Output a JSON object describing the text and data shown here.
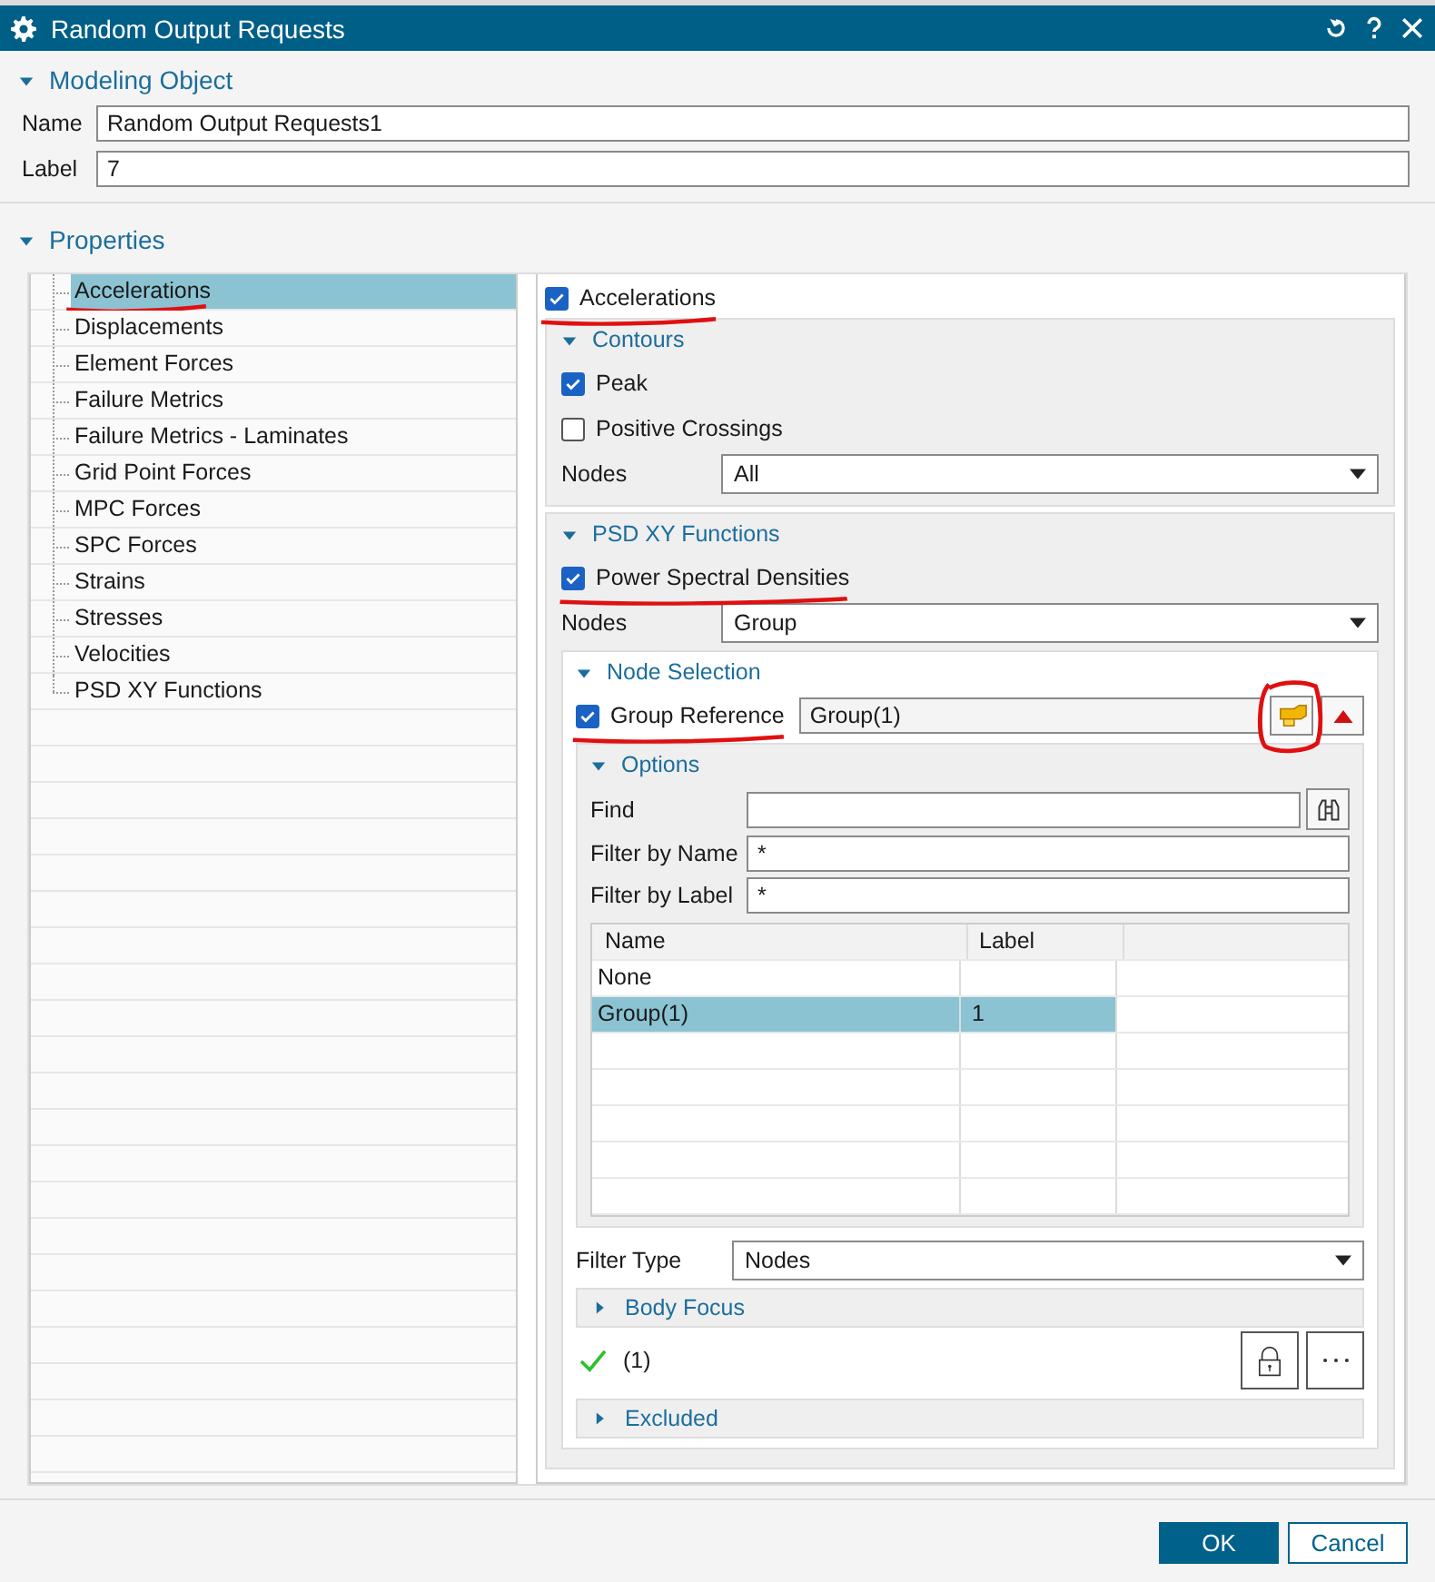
{
  "window": {
    "title": "Random Output Requests"
  },
  "modeling_object": {
    "title": "Modeling Object",
    "expanded": true,
    "fields": [
      {
        "label": "Name",
        "value": "Random Output Requests1"
      },
      {
        "label": "Label",
        "value": "7"
      }
    ]
  },
  "properties": {
    "title": "Properties",
    "expanded": true,
    "tree": [
      {
        "label": "Accelerations",
        "selected": true,
        "underlined": true
      },
      {
        "label": "Displacements",
        "selected": false
      },
      {
        "label": "Element Forces",
        "selected": false
      },
      {
        "label": "Failure Metrics",
        "selected": false
      },
      {
        "label": "Failure Metrics - Laminates",
        "selected": false
      },
      {
        "label": "Grid Point Forces",
        "selected": false
      },
      {
        "label": "MPC Forces",
        "selected": false
      },
      {
        "label": "SPC Forces",
        "selected": false
      },
      {
        "label": "Strains",
        "selected": false
      },
      {
        "label": "Stresses",
        "selected": false
      },
      {
        "label": "Velocities",
        "selected": false
      },
      {
        "label": "PSD XY Functions",
        "selected": false
      }
    ],
    "detail": {
      "enable": {
        "label": "Accelerations",
        "checked": true,
        "underlined": true
      },
      "contours": {
        "title": "Contours",
        "expanded": true,
        "checks": [
          {
            "label": "Peak",
            "checked": true
          },
          {
            "label": "Positive Crossings",
            "checked": false
          }
        ],
        "nodes": {
          "label": "Nodes",
          "value": "All"
        }
      },
      "psd": {
        "title": "PSD XY Functions",
        "expanded": true,
        "check": {
          "label": "Power Spectral Densities",
          "checked": true,
          "underlined": true
        },
        "nodes": {
          "label": "Nodes",
          "value": "Group"
        },
        "node_selection": {
          "title": "Node Selection",
          "expanded": true,
          "group_reference": {
            "label": "Group Reference",
            "checked": true,
            "underlined": true,
            "value": "Group(1)",
            "picker_circled": true
          },
          "options": {
            "title": "Options",
            "expanded": true,
            "find": {
              "label": "Find"
            },
            "filter_name": {
              "label": "Filter by Name",
              "value": "*"
            },
            "filter_label": {
              "label": "Filter by Label",
              "value": "*"
            },
            "table": {
              "columns": [
                "Name",
                "Label"
              ],
              "rows": [
                {
                  "name": "None",
                  "selected": false
                },
                {
                  "name": "Group(1)",
                  "label": "1",
                  "selected": true
                }
              ]
            }
          },
          "filter_type": {
            "label": "Filter Type",
            "value": "Nodes"
          },
          "body_focus": {
            "title": "Body Focus",
            "expanded": false
          },
          "selection": {
            "valid": true,
            "count": "(1)"
          },
          "excluded": {
            "title": "Excluded",
            "expanded": false
          }
        }
      }
    }
  },
  "buttons": [
    {
      "label": "OK",
      "kind": "primary"
    },
    {
      "label": "Cancel",
      "kind": "secondary"
    }
  ]
}
